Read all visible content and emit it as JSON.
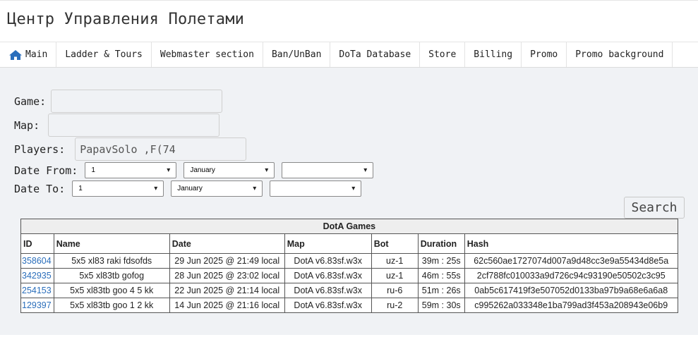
{
  "title": "Центр Управления Полетами",
  "nav": {
    "items": [
      {
        "label": "Main",
        "icon": "home-icon"
      },
      {
        "label": "Ladder & Tours"
      },
      {
        "label": "Webmaster section"
      },
      {
        "label": "Ban/UnBan"
      },
      {
        "label": "DoTa Database"
      },
      {
        "label": "Store"
      },
      {
        "label": "Billing"
      },
      {
        "label": "Promo"
      },
      {
        "label": "Promo background"
      }
    ]
  },
  "form": {
    "game_label": "Game:",
    "game_value": "",
    "map_label": "Map:",
    "map_value": "",
    "players_label": "Players:",
    "players_value": "PapavSolo ,F(74",
    "date_from_label": "Date From:",
    "date_from": {
      "day": "1",
      "month": "January",
      "year": ""
    },
    "date_to_label": "Date To:",
    "date_to": {
      "day": "1",
      "month": "January",
      "year": ""
    },
    "search_label": "Search"
  },
  "table": {
    "caption": "DotA Games",
    "headers": [
      "ID",
      "Name",
      "Date",
      "Map",
      "Bot",
      "Duration",
      "Hash"
    ],
    "rows": [
      {
        "id": "358604",
        "name": "5x5 xl83 raki fdsofds",
        "date": "29 Jun 2025 @ 21:49 local",
        "map": "DotA v6.83sf.w3x",
        "bot": "uz-1",
        "duration": "39m : 25s",
        "hash": "62c560ae1727074d007a9d48cc3e9a55434d8e5a"
      },
      {
        "id": "342935",
        "name": "5x5 xl83tb gofog",
        "date": "28 Jun 2025 @ 23:02 local",
        "map": "DotA v6.83sf.w3x",
        "bot": "uz-1",
        "duration": "46m : 55s",
        "hash": "2cf788fc010033a9d726c94c93190e50502c3c95"
      },
      {
        "id": "254153",
        "name": "5x5 xl83tb goo 4 5 kk",
        "date": "22 Jun 2025 @ 21:14 local",
        "map": "DotA v6.83sf.w3x",
        "bot": "ru-6",
        "duration": "51m : 26s",
        "hash": "0ab5c617419f3e507052d0133ba97b9a68e6a6a8"
      },
      {
        "id": "129397",
        "name": "5x5 xl83tb goo 1 2 kk",
        "date": "14 Jun 2025 @ 21:16 local",
        "map": "DotA v6.83sf.w3x",
        "bot": "ru-2",
        "duration": "59m : 30s",
        "hash": "c995262a033348e1ba799ad3f453a208943e06b9"
      }
    ]
  },
  "colors": {
    "link": "#2a6ebb",
    "home_icon": "#2a6ebb",
    "page_bg": "#f0f2f5"
  }
}
